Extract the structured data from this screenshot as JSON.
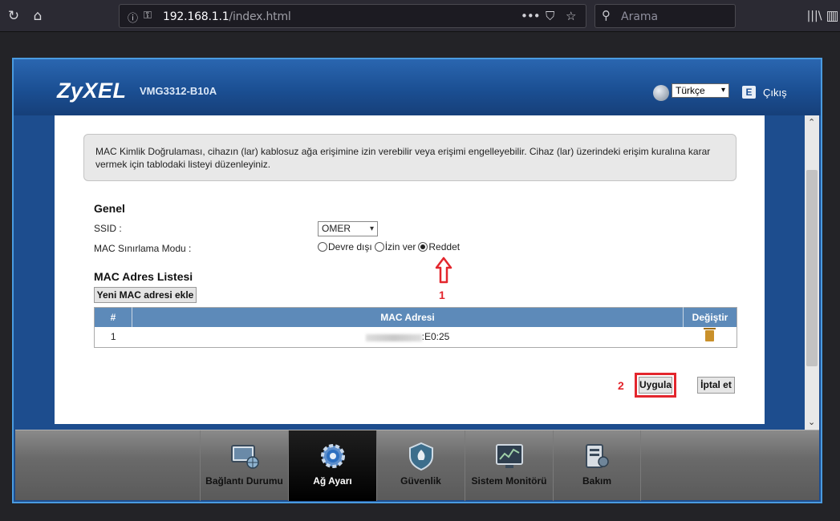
{
  "browser": {
    "url_host": "192.168.1.1",
    "url_path": "/index.html",
    "search_placeholder": "Arama",
    "reload_icon": "↻",
    "home_icon": "⌂",
    "more_icon": "•••",
    "pocket_icon": "⛉",
    "star_icon": "☆",
    "library_icon": "|||\\",
    "sidebar_icon": "▥"
  },
  "header": {
    "brand": "ZyXEL",
    "model": "VMG3312-B10A",
    "language": "Türkçe",
    "logout_label": "Çıkış",
    "logout_icon": "E"
  },
  "content": {
    "info_text": "MAC Kimlik Doğrulaması, cihazın (lar) kablosuz ağa erişimine izin verebilir veya erişimi engelleyebilir. Cihaz (lar) üzerindeki erişim kuralına karar vermek için tablodaki listeyi düzenleyiniz.",
    "general_title": "Genel",
    "ssid_label": "SSID :",
    "ssid_value": "OMER",
    "mode_label": "MAC Sınırlama Modu :",
    "mode_options": [
      "Devre dışı",
      "İzin ver",
      "Reddet"
    ],
    "annotation_1": "1",
    "annotation_2": "2",
    "list_title": "MAC Adres Listesi",
    "add_button": "Yeni MAC adresi ekle",
    "table": {
      "headers": [
        "#",
        "MAC Adresi",
        "Değiştir"
      ],
      "rows": [
        {
          "index": "1",
          "mac_suffix": ":E0:25"
        }
      ]
    },
    "apply_button": "Uygula",
    "cancel_button": "İptal et"
  },
  "nav": {
    "items": [
      {
        "label": "Bağlantı Durumu"
      },
      {
        "label": "Ağ Ayarı"
      },
      {
        "label": "Güvenlik"
      },
      {
        "label": "Sistem Monitörü"
      },
      {
        "label": "Bakım"
      }
    ]
  },
  "colors": {
    "annotation_red": "#e3262d",
    "header_blue": "#1b4f93",
    "table_header": "#5d8ab9"
  }
}
